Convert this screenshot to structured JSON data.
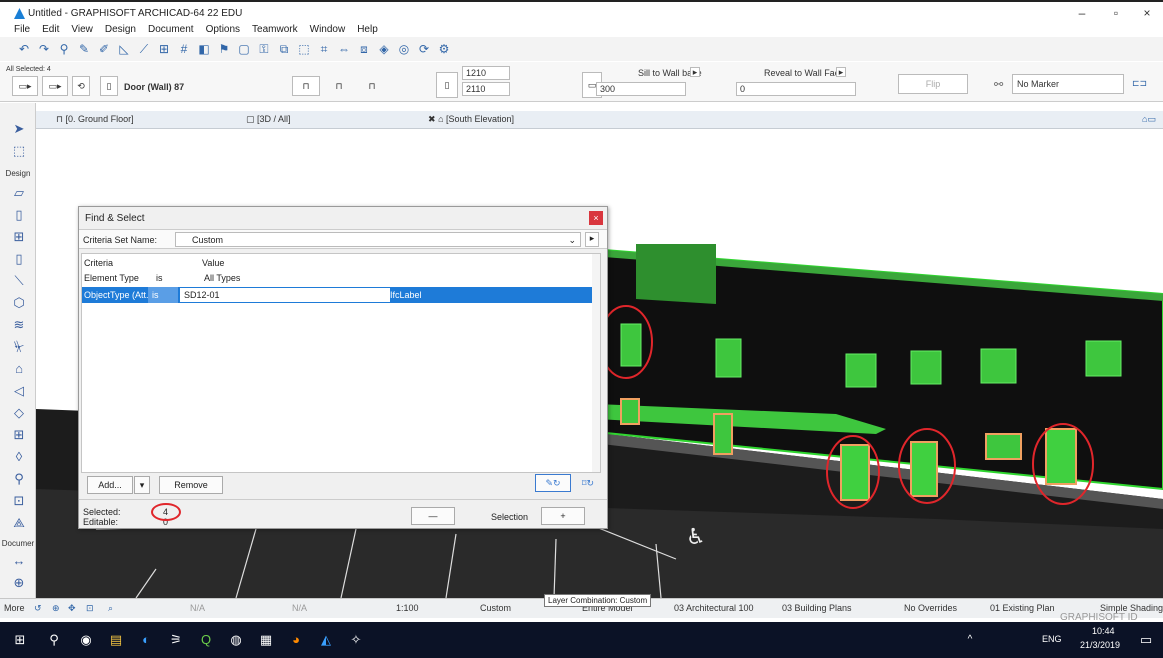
{
  "window": {
    "title": "Untitled - GRAPHISOFT ARCHICAD-64 22 EDU",
    "controls": [
      "–",
      "▫",
      "×"
    ]
  },
  "menu": [
    "File",
    "Edit",
    "View",
    "Design",
    "Document",
    "Options",
    "Teamwork",
    "Window",
    "Help"
  ],
  "infobox": {
    "all_selected": "All Selected: 4",
    "element": "Door (Wall) 87",
    "height1": "1210",
    "height2": "2110",
    "sill_label": "Sill to Wall base",
    "sill_value": "300",
    "reveal_label": "Reveal to Wall Face",
    "reveal_value": "0",
    "flip": "Flip",
    "marker": "No Marker"
  },
  "tabs": [
    "[0. Ground Floor]",
    "[3D / All]",
    "[South Elevation]"
  ],
  "leftbar": {
    "design_label": "Design",
    "document_label": "Documer",
    "more_label": "More"
  },
  "dialog": {
    "title": "Find & Select",
    "criteria_set_label": "Criteria Set Name:",
    "criteria_set_value": "Custom",
    "col_criteria": "Criteria",
    "col_value": "Value",
    "row1": {
      "criteria": "Element Type",
      "op": "is",
      "value": "All Types"
    },
    "row2": {
      "criteria": "ObjectType (Att...",
      "op": "is",
      "value": "SD12-01",
      "type": "IfcLabel"
    },
    "add_label": "Add...",
    "remove_label": "Remove",
    "selected_label": "Selected:",
    "selected_value": "4",
    "editable_label": "Editable:",
    "editable_value": "0",
    "minus_label": "—",
    "selection_label": "Selection",
    "plus_label": "+"
  },
  "statusbar": {
    "more": "More",
    "na1": "N/A",
    "na2": "N/A",
    "scale": "1:100",
    "layer": "Custom",
    "model": "Entire Model",
    "tooltip": "Layer Combination: Custom",
    "arch": "03 Architectural 100",
    "plans": "03 Building Plans",
    "overrides": "No Overrides",
    "existing": "01 Existing Plan",
    "shading": "Simple Shading",
    "graphisoft": "GRAPHISOFT ID"
  },
  "taskbar": {
    "lang": "ENG",
    "time": "10:44",
    "date": "21/3/2019"
  },
  "colors": {
    "selection_blue": "#1e7bd8",
    "highlight_green": "#35c23a",
    "annotation_red": "#e0262b",
    "taskbar": "#0b1226"
  }
}
